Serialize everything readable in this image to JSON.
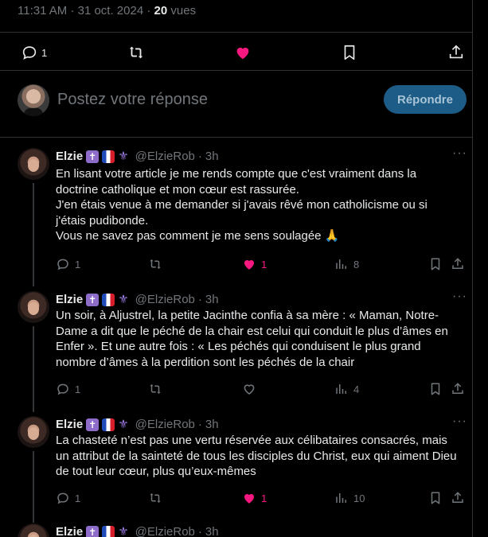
{
  "meta": {
    "time": "11:31 AM",
    "sep": "·",
    "date": "31 oct. 2024",
    "views_count": "20",
    "views_label": "vues"
  },
  "main_actions": {
    "reply_count": "1"
  },
  "reply_box": {
    "placeholder": "Postez votre réponse",
    "button": "Répondre"
  },
  "tweets": [
    {
      "name": "Elzie",
      "handle": "@ElzieRob",
      "time": "3h",
      "more": "···",
      "lines": [
        "En lisant votre article je me rends compte que c'est vraiment dans la doctrine catholique et mon cœur est rassurée.",
        "J'en étais venue à me demander si j'avais rêvé mon catholicisme ou si j'étais pudibonde.",
        "Vous ne savez pas comment je me sens soulagée 🙏"
      ],
      "replies": "1",
      "likes": "1",
      "views": "8",
      "liked": true
    },
    {
      "name": "Elzie",
      "handle": "@ElzieRob",
      "time": "3h",
      "more": "···",
      "lines": [
        "Un soir, à Aljustrel, la petite Jacinthe confia à sa mère : « Maman, Notre-Dame a dit que le péché de la chair est celui qui conduit le plus d’âmes en Enfer ». Et une autre fois : « Les péchés qui conduisent le plus grand nombre d’âmes à la perdition sont les péchés de la chair"
      ],
      "replies": "1",
      "likes": "",
      "views": "4",
      "liked": false
    },
    {
      "name": "Elzie",
      "handle": "@ElzieRob",
      "time": "3h",
      "more": "···",
      "lines": [
        "La chasteté n’est pas une vertu réservée aux célibataires consacrés, mais un attribut de la sainteté de tous les disciples du Christ, eux qui aiment Dieu de tout leur cœur, plus qu’eux-mêmes"
      ],
      "replies": "1",
      "likes": "1",
      "views": "10",
      "liked": true
    },
    {
      "name": "Elzie",
      "handle": "@ElzieRob",
      "time": "3h"
    }
  ],
  "colors": {
    "accent": "#1d9bf0",
    "like": "#f91880",
    "muted": "#71767b",
    "button_disabled": "#1d5c86"
  },
  "icons": [
    "reply-icon",
    "repost-icon",
    "heart-icon",
    "views-icon",
    "bookmark-icon",
    "share-icon",
    "cross-emoji-icon",
    "french-flag-icon",
    "fleur-de-lis-icon"
  ]
}
